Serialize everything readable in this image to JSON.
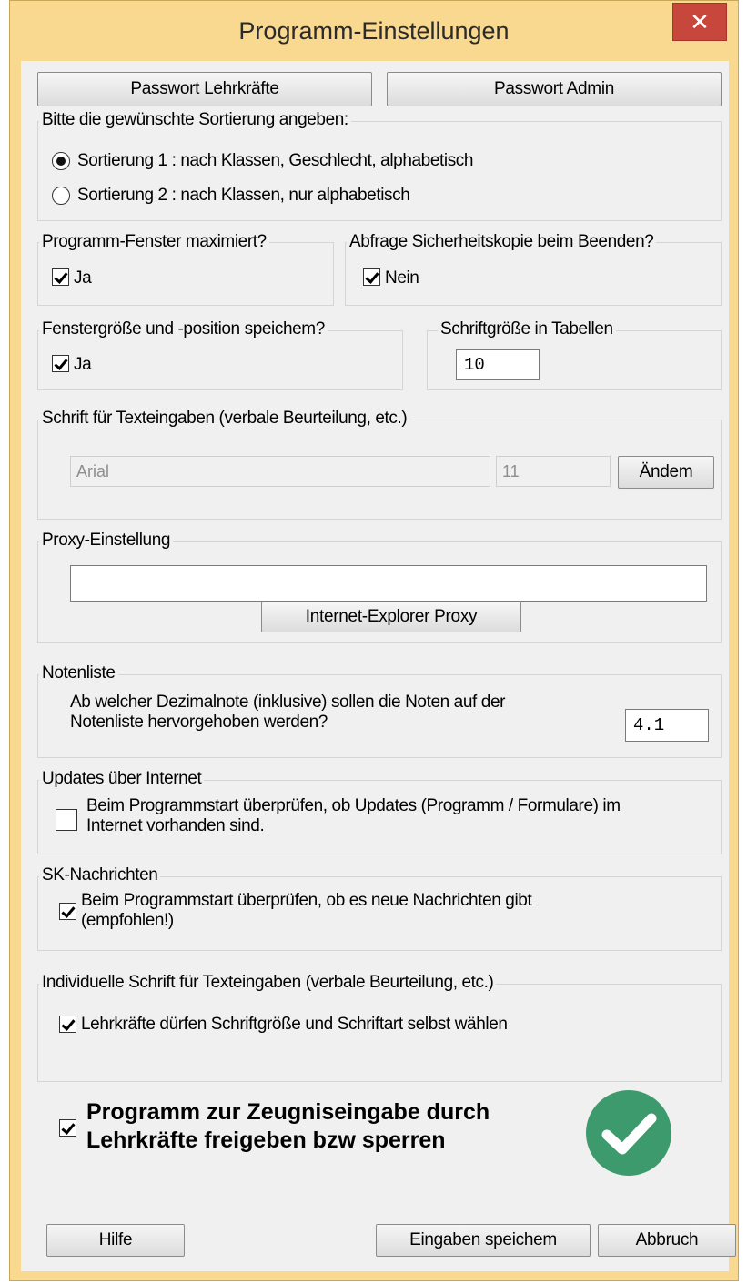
{
  "window": {
    "title": "Programm-Einstellungen",
    "close_glyph": "✕"
  },
  "top_buttons": {
    "password_teachers": "Passwort Lehrkräfte",
    "password_admin": "Passwort Admin"
  },
  "sorting": {
    "label": "Bitte die gewünschte Sortierung angeben:",
    "options": [
      {
        "label": "Sortierung 1 : nach Klassen, Geschlecht, alphabetisch",
        "selected": true
      },
      {
        "label": "Sortierung 2 : nach Klassen, nur alphabetisch",
        "selected": false
      }
    ]
  },
  "maximized": {
    "label": "Programm-Fenster maximiert?",
    "checkbox_label": "Ja",
    "checked": true
  },
  "backup_prompt": {
    "label": "Abfrage Sicherheitskopie beim Beenden?",
    "checkbox_label": "Nein",
    "checked": true
  },
  "window_save": {
    "label": "Fenstergröße und -position speichem?",
    "checkbox_label": "Ja",
    "checked": true
  },
  "table_font_size": {
    "label": "Schriftgröße in Tabellen",
    "value": "10"
  },
  "text_font": {
    "label": "Schrift für Texteingaben (verbale Beurteilung, etc.)",
    "font_name": "Arial",
    "font_size": "11",
    "change_button": "Ändem"
  },
  "proxy": {
    "label": "Proxy-Einstellung",
    "value": "",
    "ie_button": "Internet-Explorer Proxy"
  },
  "grade_list": {
    "label": "Notenliste",
    "line1": "Ab welcher Dezimalnote (inklusive) sollen die Noten auf der",
    "line2": "Notenliste hervorgehoben werden?",
    "value": "4.1"
  },
  "updates": {
    "label": "Updates über Internet",
    "line1": "Beim Programmstart überprüfen, ob Updates (Programm / Formulare)  im",
    "line2": "Internet vorhanden sind.",
    "checked": false
  },
  "messages": {
    "label": "SK-Nachrichten",
    "line1": "Beim Programmstart überprüfen, ob es neue  Nachrichten gibt",
    "line2": "(empfohlen!)",
    "checked": true
  },
  "individual_font": {
    "label": "Individuelle Schrift für Texteingaben (verbale Beurteilung, etc.)",
    "checkbox_label": "Lehrkräfte dürfen Schriftgröße und Schriftart selbst wählen",
    "checked": true
  },
  "release": {
    "line1": "Programm zur Zeugniseingabe durch",
    "line2": "Lehrkräfte freigeben bzw sperren",
    "checked": true,
    "status_color": "#3c9a6c"
  },
  "bottom_buttons": {
    "help": "Hilfe",
    "save": "Eingaben speichem",
    "cancel": "Abbruch"
  }
}
